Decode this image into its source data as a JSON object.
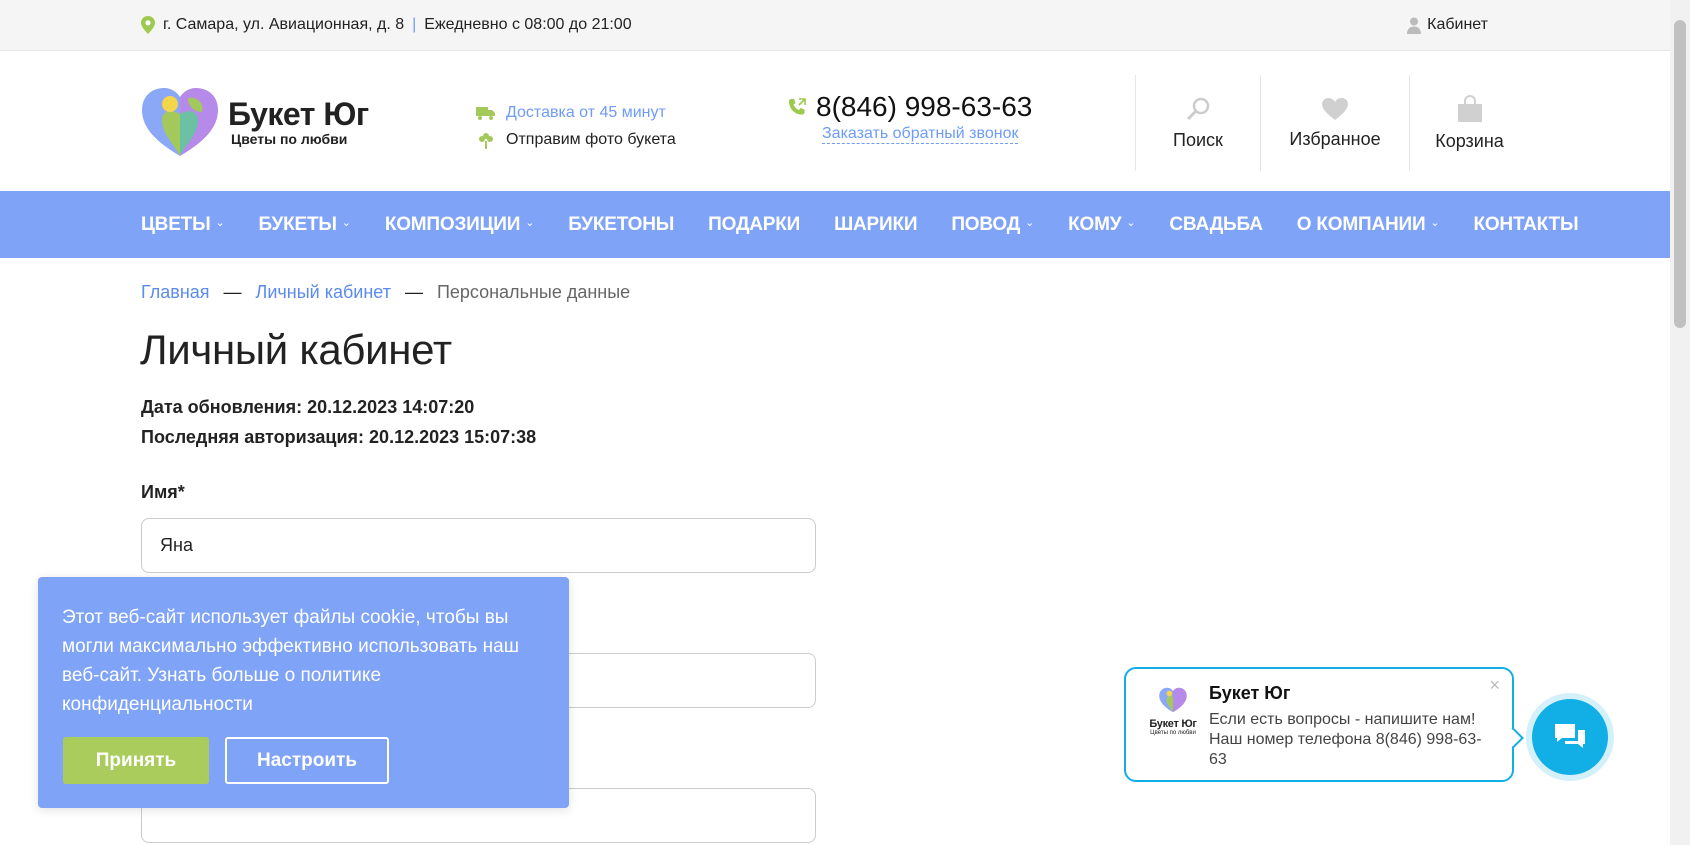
{
  "topbar": {
    "address": "г. Самара, ул. Авиационная, д. 8",
    "separator": "|",
    "hours": "Ежедневно с 08:00 до 21:00",
    "cabinet": "Кабинет"
  },
  "header": {
    "brand": "Букет Юг",
    "slogan": "Цветы по любви",
    "delivery": "Доставка от 45 минут",
    "photo": "Отправим фото букета",
    "phone": "8(846) 998-63-63",
    "callback": "Заказать обратный звонок",
    "search": "Поиск",
    "favorites": "Избранное",
    "cart": "Корзина"
  },
  "nav": {
    "items": [
      {
        "label": "Цветы",
        "dropdown": true
      },
      {
        "label": "Букеты",
        "dropdown": true
      },
      {
        "label": "Композиции",
        "dropdown": true
      },
      {
        "label": "Букетоны",
        "dropdown": false
      },
      {
        "label": "Подарки",
        "dropdown": false
      },
      {
        "label": "Шарики",
        "dropdown": false
      },
      {
        "label": "Повод",
        "dropdown": true
      },
      {
        "label": "Кому",
        "dropdown": true
      },
      {
        "label": "Свадьба",
        "dropdown": false
      },
      {
        "label": "О компании",
        "dropdown": true
      },
      {
        "label": "Контакты",
        "dropdown": false
      }
    ]
  },
  "breadcrumb": {
    "home": "Главная",
    "cabinet": "Личный кабинет",
    "current": "Персональные данные",
    "sep": "—"
  },
  "page": {
    "title": "Личный кабинет",
    "updated": "Дата обновления: 20.12.2023 14:07:20",
    "last_login": "Последняя авторизация: 20.12.2023 15:07:38"
  },
  "form": {
    "name_label": "Имя*",
    "name_value": "Яна",
    "field2_value": "",
    "field3_value": ""
  },
  "cookie": {
    "text": "Этот веб-сайт использует файлы cookie, чтобы вы могли максимально эффективно использовать наш веб-сайт. Узнать больше о политике конфиденциальности",
    "accept": "Принять",
    "configure": "Настроить"
  },
  "chat": {
    "name": "Букет Юг",
    "message": "Если есть вопросы - напишите нам! Наш номер телефона 8(846) 998-63-63",
    "logo_brand": "Букет Юг",
    "logo_slogan": "Цветы по любви",
    "close": "×"
  },
  "colors": {
    "accent": "#7fa3f7",
    "link": "#6f9cf8",
    "green": "#a9cc5c",
    "chat": "#12aee6"
  },
  "icons": [
    "location-pin-icon",
    "user-icon",
    "truck-icon",
    "flower-icon",
    "phone-icon",
    "search-icon",
    "heart-icon",
    "bag-icon",
    "chevron-down-icon",
    "chat-icon",
    "close-icon"
  ]
}
